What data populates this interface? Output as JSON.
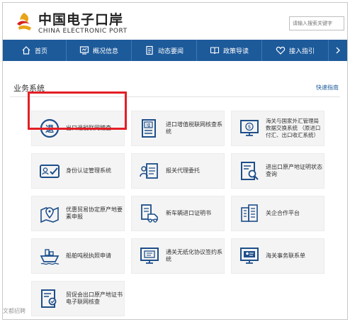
{
  "header": {
    "brand_cn": "中国电子口岸",
    "brand_en": "CHINA ELECTRONIC PORT",
    "search_placeholder": "请输入搜索关键字"
  },
  "nav": [
    {
      "label": "首页",
      "icon": "home-icon"
    },
    {
      "label": "概况信息",
      "icon": "monitor-icon"
    },
    {
      "label": "动态要闻",
      "icon": "document-icon"
    },
    {
      "label": "政策导读",
      "icon": "book-icon"
    },
    {
      "label": "接入指引",
      "icon": "heart-icon"
    }
  ],
  "section": {
    "title": "业务系统",
    "quick_link": "快速指南"
  },
  "tiles": [
    {
      "label": "出口退税联网稽查",
      "icon": "tui-circle-icon"
    },
    {
      "label": "进口增值税联网核查系统",
      "icon": "zeng-document-icon"
    },
    {
      "label": "海关与国家外汇管理局数据交换系统 （原进口付汇、出口收汇系统）",
      "icon": "currency-monitor-icon"
    },
    {
      "label": "身份认证管理系统",
      "icon": "id-card-icon"
    },
    {
      "label": "报关代理委托",
      "icon": "agent-clipboard-icon"
    },
    {
      "label": "进出口原产地证明状态查询",
      "icon": "certificate-search-icon"
    },
    {
      "label": "优惠贸易协定原产地要素申报",
      "icon": "map-pin-icon"
    },
    {
      "label": "新车辆进口证明书",
      "icon": "truck-document-icon"
    },
    {
      "label": "关企合作平台",
      "icon": "building-icon"
    },
    {
      "label": "船舶吨税执照申请",
      "icon": "ship-icon"
    },
    {
      "label": "通关无纸化协议签约系统",
      "icon": "paperless-monitor-icon"
    },
    {
      "label": "海关事务联系单",
      "icon": "contact-monitor-icon"
    },
    {
      "label": "贸促会出口原产地证书电子联网核查",
      "icon": "certificate-check-icon"
    }
  ],
  "watermark": "文都招聘",
  "colors": {
    "nav": "#1d5a9a",
    "highlight": "#e31e24",
    "tile_bg": "#f4f4f4"
  }
}
